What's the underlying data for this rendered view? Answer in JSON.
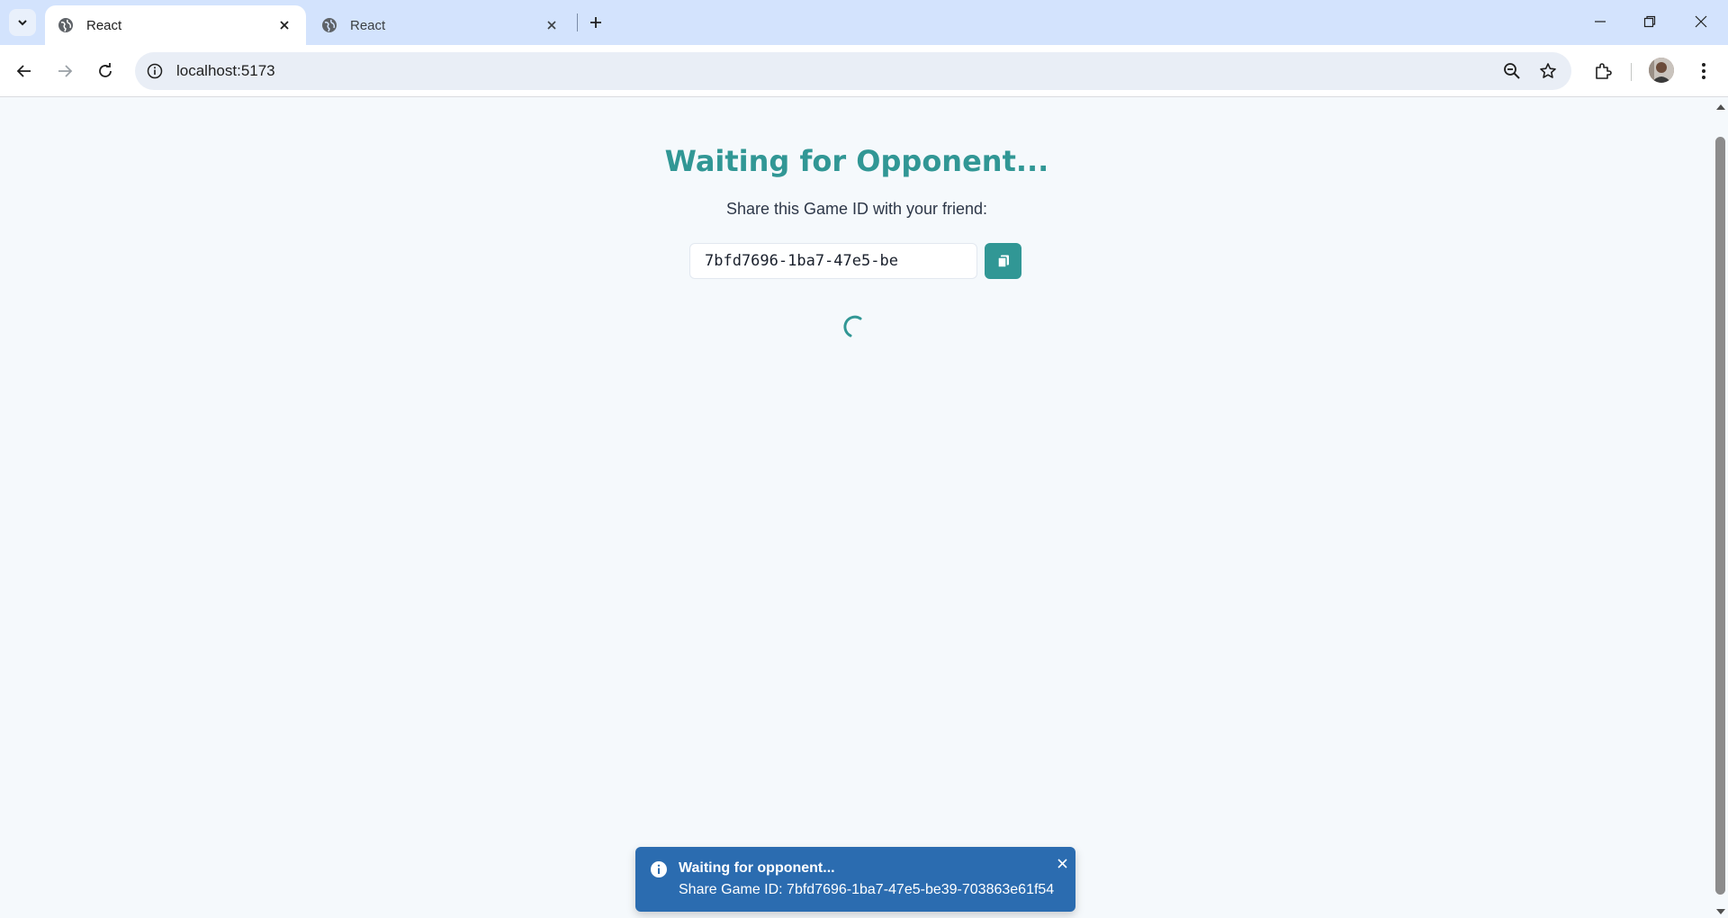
{
  "browser": {
    "tabs": [
      {
        "title": "React",
        "active": true
      },
      {
        "title": "React",
        "active": false
      }
    ],
    "url": "localhost:5173",
    "icons": {
      "tab_search": "chevron-down-icon",
      "favicon": "globe-icon",
      "tab_close": "close-icon",
      "new_tab": "plus-icon",
      "back": "arrow-left-icon",
      "forward": "arrow-right-icon",
      "reload": "reload-icon",
      "site_info": "info-icon",
      "zoom": "zoom-out-icon",
      "bookmark": "star-icon",
      "extensions": "puzzle-icon",
      "profile": "avatar",
      "menu": "kebab-menu-icon"
    }
  },
  "page": {
    "heading": "Waiting for Opponent...",
    "subheading": "Share this Game ID with your friend:",
    "game_id_value": "7bfd7696-1ba7-47e5-be",
    "copy_icon": "copy-icon",
    "accent_color": "#319795"
  },
  "toast": {
    "title": "Waiting for opponent...",
    "description": "Share Game ID: 7bfd7696-1ba7-47e5-be39-703863e61f54",
    "background": "#2b6cb0"
  }
}
